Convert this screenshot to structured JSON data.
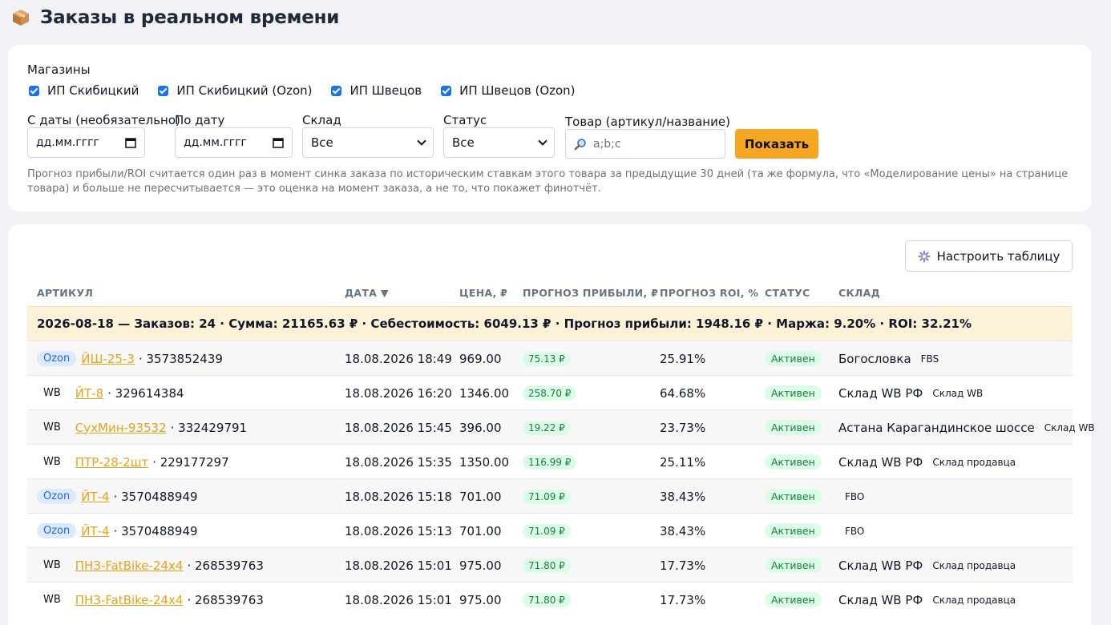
{
  "page": {
    "title": "Заказы в реальном времени",
    "icon": "package-icon"
  },
  "filters": {
    "shops_label": "Магазины",
    "shops": [
      {
        "label": "ИП Скибицкий",
        "checked": true
      },
      {
        "label": "ИП Скибицкий (Ozon)",
        "checked": true
      },
      {
        "label": "ИП Швецов",
        "checked": true
      },
      {
        "label": "ИП Швецов (Ozon)",
        "checked": true
      }
    ],
    "date_from": {
      "label": "С даты (необязательно)",
      "value": "дд.мм.гггг"
    },
    "date_to": {
      "label": "По дату",
      "value": "дд.мм.гггг"
    },
    "warehouse": {
      "label": "Склад",
      "value": "Все"
    },
    "status": {
      "label": "Статус",
      "value": "Все"
    },
    "product": {
      "label": "Товар (артикул/название)",
      "placeholder": "a;b;c"
    },
    "show_button": "Показать",
    "note": "Прогноз прибыли/ROI считается один раз в момент синка заказа по историческим ставкам этого товара за предыдущие 30 дней (та же формула, что «Моделирование цены» на странице товара) и больше не пересчитывается — это оценка на момент заказа, а не то, что покажет финотчёт."
  },
  "table": {
    "settings_button": "Настроить таблицу",
    "columns": {
      "sku": "АРТИКУЛ",
      "date": "ДАТА",
      "sort_indicator": "▼",
      "price": "ЦЕНА, ₽",
      "profit": "ПРОГНОЗ ПРИБЫЛИ, ₽",
      "roi": "ПРОГНОЗ ROI, %",
      "status": "СТАТУС",
      "warehouse": "СКЛАД"
    },
    "summary": "2026-08-18 — Заказов: 24 · Сумма: 21165.63 ₽ · Себестоимость: 6049.13 ₽ · Прогноз прибыли: 1948.16 ₽ · Маржа: 9.20% · ROI: 32.21%",
    "rows": [
      {
        "mp": "Ozon",
        "sku": "ЙШ-25-3",
        "id": "· 3573852439",
        "date": "18.08.2026 18:49",
        "price": "969.00",
        "profit": "75.13 ₽",
        "roi": "25.91%",
        "status": "Активен",
        "warehouse": "Богословка",
        "wh_type": "FBS"
      },
      {
        "mp": "WB",
        "sku": "ЙТ-8",
        "id": "· 329614384",
        "date": "18.08.2026 16:20",
        "price": "1346.00",
        "profit": "258.70 ₽",
        "roi": "64.68%",
        "status": "Активен",
        "warehouse": "Склад WB РФ",
        "wh_type": "Склад WB"
      },
      {
        "mp": "WB",
        "sku": "СухМин-93532",
        "id": "· 332429791",
        "date": "18.08.2026 15:45",
        "price": "396.00",
        "profit": "19.22 ₽",
        "roi": "23.73%",
        "status": "Активен",
        "warehouse": "Астана Карагандинское шоссе",
        "wh_type": "Склад WB"
      },
      {
        "mp": "WB",
        "sku": "ПТР-28-2шт",
        "id": "· 229177297",
        "date": "18.08.2026 15:35",
        "price": "1350.00",
        "profit": "116.99 ₽",
        "roi": "25.11%",
        "status": "Активен",
        "warehouse": "Склад WB РФ",
        "wh_type": "Склад продавца"
      },
      {
        "mp": "Ozon",
        "sku": "ЙТ-4",
        "id": "· 3570488949",
        "date": "18.08.2026 15:18",
        "price": "701.00",
        "profit": "71.09 ₽",
        "roi": "38.43%",
        "status": "Активен",
        "warehouse": "",
        "wh_type": "FBO"
      },
      {
        "mp": "Ozon",
        "sku": "ЙТ-4",
        "id": "· 3570488949",
        "date": "18.08.2026 15:13",
        "price": "701.00",
        "profit": "71.09 ₽",
        "roi": "38.43%",
        "status": "Активен",
        "warehouse": "",
        "wh_type": "FBO"
      },
      {
        "mp": "WB",
        "sku": "ПНЗ-FatBike-24x4",
        "id": "· 268539763",
        "date": "18.08.2026 15:01",
        "price": "975.00",
        "profit": "71.80 ₽",
        "roi": "17.73%",
        "status": "Активен",
        "warehouse": "Склад WB РФ",
        "wh_type": "Склад продавца"
      },
      {
        "mp": "WB",
        "sku": "ПНЗ-FatBike-24x4",
        "id": "· 268539763",
        "date": "18.08.2026 15:01",
        "price": "975.00",
        "profit": "71.80 ₽",
        "roi": "17.73%",
        "status": "Активен",
        "warehouse": "Склад WB РФ",
        "wh_type": "Склад продавца"
      }
    ]
  },
  "colors": {
    "accent": "#f5a623",
    "link": "#e8a317",
    "ozon_bg": "#dbeafe",
    "ozon_fg": "#2563eb",
    "positive_bg": "#dcfce7",
    "positive_fg": "#15803d",
    "summary_bg": "#fdf1d8"
  }
}
